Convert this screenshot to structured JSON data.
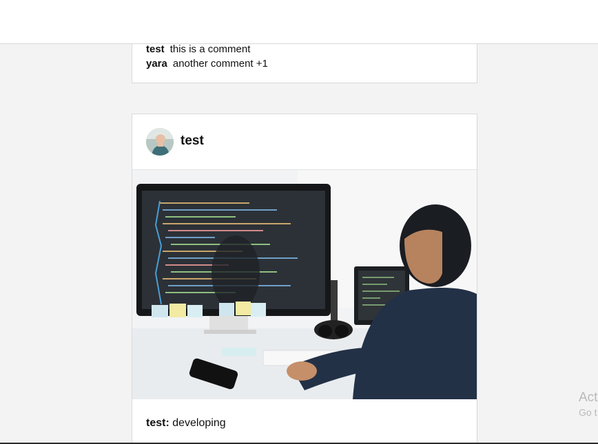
{
  "previous_post": {
    "comments": [
      {
        "author": "test",
        "text": "this is a comment"
      },
      {
        "author": "yara",
        "text": "another comment +1"
      }
    ]
  },
  "post": {
    "username": "test",
    "caption_user": "test:",
    "caption_text": "developing"
  },
  "watermark": {
    "line1": "Act",
    "line2": "Go t"
  }
}
